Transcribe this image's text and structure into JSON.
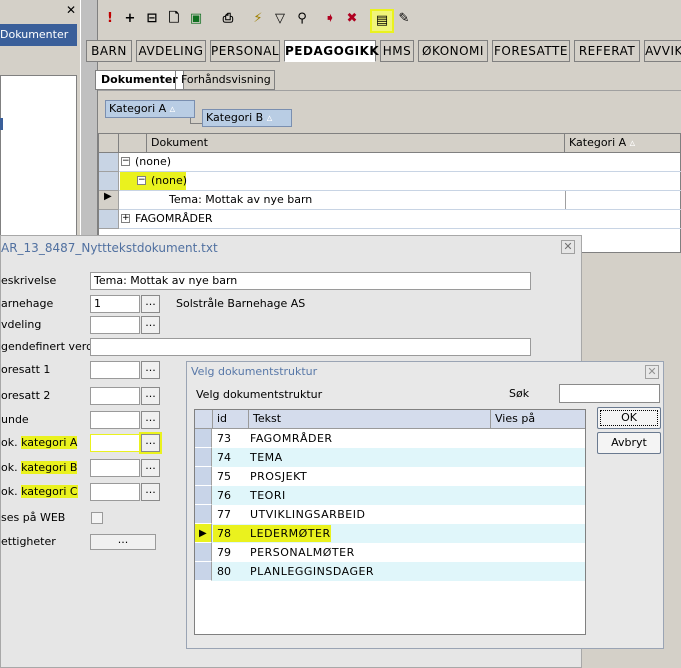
{
  "left_panel": {
    "item": "Dokumenter"
  },
  "toolbar": {
    "icons": [
      "exclamation-icon",
      "plus-icon",
      "tree-icon",
      "preview-icon",
      "excel-icon",
      "printer-icon",
      "filter-lightning-icon",
      "filter-icon",
      "binoculars-icon",
      "arrow-star-icon",
      "cross-arrow-icon",
      "edit-properties-icon",
      "pencil-icon"
    ]
  },
  "tabs": [
    "BARN",
    "AVDELING",
    "PERSONAL",
    "PEDAGOGIKK",
    "HMS",
    "ØKONOMI",
    "FORESATTE",
    "REFERAT",
    "AVVIK"
  ],
  "active_tab": "PEDAGOGIKK",
  "subtabs": [
    "Dokumenter",
    "Forhåndsvisning"
  ],
  "group_chips": {
    "a": "Kategori A",
    "b": "Kategori B"
  },
  "grid": {
    "headers": {
      "document": "Dokument",
      "category": "Kategori A"
    },
    "rows": {
      "none1": "(none)",
      "none2": "(none)",
      "theme": "Tema: Mottak av nye barn",
      "fag": "FAGOMRÅDER"
    }
  },
  "doc_window": {
    "title": "AR_13_8487_Nytttekstdokument.txt",
    "labels": {
      "beskrivelse": "eskrivelse",
      "barnehage": "arnehage",
      "avdeling": "vdeling",
      "egendefinert": "gendefinert verdi",
      "foresatt1": "oresatt 1",
      "foresatt2": "oresatt 2",
      "kunde": "unde",
      "katA_prefix": "ok.",
      "katA": "kategori A",
      "katB_prefix": "ok.",
      "katB": "kategori B",
      "katC_prefix": "ok.",
      "katC": "kategori C",
      "web": "ses på WEB",
      "rettigheter": "ettigheter"
    },
    "values": {
      "beskrivelse": "Tema: Mottak av nye barn",
      "barnehage_id": "1",
      "barnehage_name": "Solstråle Barnehage AS",
      "lookup_btn": "...",
      "rights_btn": "..."
    }
  },
  "dialog": {
    "title": "Velg dokumentstruktur",
    "heading": "Velg dokumentstruktur",
    "search_label": "Søk",
    "search_value": "",
    "headers": {
      "id": "id",
      "tekst": "Tekst",
      "vies": "Vies på"
    },
    "rows": [
      {
        "id": "73",
        "text": "FAGOMRÅDER"
      },
      {
        "id": "74",
        "text": "TEMA"
      },
      {
        "id": "75",
        "text": "PROSJEKT"
      },
      {
        "id": "76",
        "text": "TEORI"
      },
      {
        "id": "77",
        "text": "UTVIKLINGSARBEID"
      },
      {
        "id": "78",
        "text": "LEDERMØTER"
      },
      {
        "id": "79",
        "text": "PERSONALMØTER"
      },
      {
        "id": "80",
        "text": "PLANLEGGINSDAGER"
      }
    ],
    "ok": "OK",
    "cancel": "Avbryt"
  }
}
